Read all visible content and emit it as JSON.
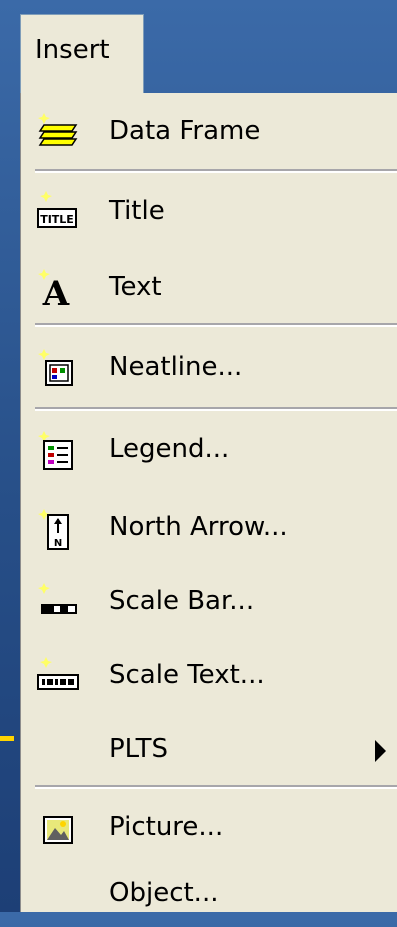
{
  "menubar": {
    "label": "Insert"
  },
  "menu": {
    "items": [
      {
        "label": "Data Frame",
        "icon": "data-frame-icon"
      },
      {
        "label": "Title",
        "icon": "title-icon"
      },
      {
        "label": "Text",
        "icon": "text-icon"
      },
      {
        "label": "Neatline...",
        "icon": "neatline-icon"
      },
      {
        "label": "Legend...",
        "icon": "legend-icon"
      },
      {
        "label": "North Arrow...",
        "icon": "north-arrow-icon"
      },
      {
        "label": "Scale Bar...",
        "icon": "scale-bar-icon"
      },
      {
        "label": "Scale Text...",
        "icon": "scale-text-icon"
      },
      {
        "label": "PLTS",
        "submenu": true
      },
      {
        "label": "Picture...",
        "icon": "picture-icon"
      },
      {
        "label": "Object..."
      }
    ]
  },
  "colors": {
    "menu_bg": "#ece9d8",
    "desktop_bg": "#2b5592",
    "spark": "#ffff66"
  }
}
